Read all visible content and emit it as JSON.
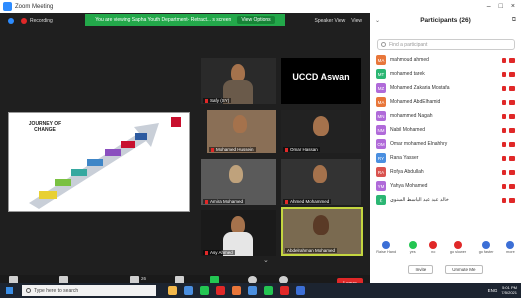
{
  "window": {
    "title": "Zoom Meeting"
  },
  "banner": {
    "text": "You are viewing Sapha Youth Department- Retract... s screen",
    "options_label": "View Options"
  },
  "recording": {
    "label": "Recording"
  },
  "view": {
    "speaker_label": "Speaker View",
    "layout_label": "View"
  },
  "shared_screen": {
    "title": "JOURNEY OF CHANGE"
  },
  "tiles": [
    {
      "name": "Safy (SY)"
    },
    {
      "name": "UCCD Aswan",
      "label": "UCCD Aswan"
    },
    {
      "name": "Mohamed Hussein"
    },
    {
      "name": "Omar Hassan"
    },
    {
      "name": "Amira Mohamed"
    },
    {
      "name": "Ahmed Mohammed"
    },
    {
      "name": "Asy Ahmed"
    },
    {
      "name": "Abdelrahman Mohamed"
    }
  ],
  "toolbar": {
    "unmute": "Unmute",
    "start_video": "Start Video",
    "participants": "Participants",
    "participants_count": "26",
    "chat": "Chat",
    "share": "Share Screen",
    "record": "Record",
    "reactions": "Reactions",
    "leave": "Leave"
  },
  "panel": {
    "title": "Participants (26)",
    "search_placeholder": "Find a participant",
    "participants": [
      {
        "initials": "MA",
        "name": "mahmoud ahmed",
        "color": "#e8763a"
      },
      {
        "initials": "MT",
        "name": "mohamed tarek",
        "color": "#2bb673"
      },
      {
        "initials": "MZ",
        "name": "Mohamed Zakaria Mostafa",
        "color": "#b06ad9"
      },
      {
        "initials": "MA",
        "name": "Mohamed AbdElhamid",
        "color": "#e8763a"
      },
      {
        "initials": "MN",
        "name": "mohammed Nagah",
        "color": "#b06ad9"
      },
      {
        "initials": "NM",
        "name": "Nabil Mohamed",
        "color": "#b06ad9"
      },
      {
        "initials": "OM",
        "name": "Omar mohamed Elnahhry",
        "color": "#b06ad9"
      },
      {
        "initials": "RY",
        "name": "Rana Yasser",
        "color": "#4a8fe0"
      },
      {
        "initials": "RA",
        "name": "Rofya Abdullah",
        "color": "#d9534f"
      },
      {
        "initials": "YM",
        "name": "Yahya Mohamed",
        "color": "#b06ad9"
      },
      {
        "initials": "ع",
        "name": "خالد عبد عبد الباسط السنوي",
        "color": "#2bb673"
      }
    ],
    "reactions": [
      {
        "label": "Raise Hand",
        "color": "#3c6fd6"
      },
      {
        "label": "yes",
        "color": "#23c552"
      },
      {
        "label": "no",
        "color": "#e02828"
      },
      {
        "label": "go slower",
        "color": "#e02828"
      },
      {
        "label": "go faster",
        "color": "#3c6fd6"
      },
      {
        "label": "more",
        "color": "#3c6fd6"
      }
    ],
    "invite_label": "Invite",
    "unmute_me_label": "Unmute Me"
  },
  "taskbar": {
    "search_placeholder": "Type here to search",
    "lang": "ENG",
    "time": "5:01 PM",
    "date": "7/5/2021",
    "apps": [
      "#f2b84b",
      "#4a8fe0",
      "#23c552",
      "#e02828",
      "#e8763a",
      "#4a8fe0",
      "#23c552",
      "#e02828",
      "#3c6fd6"
    ]
  }
}
